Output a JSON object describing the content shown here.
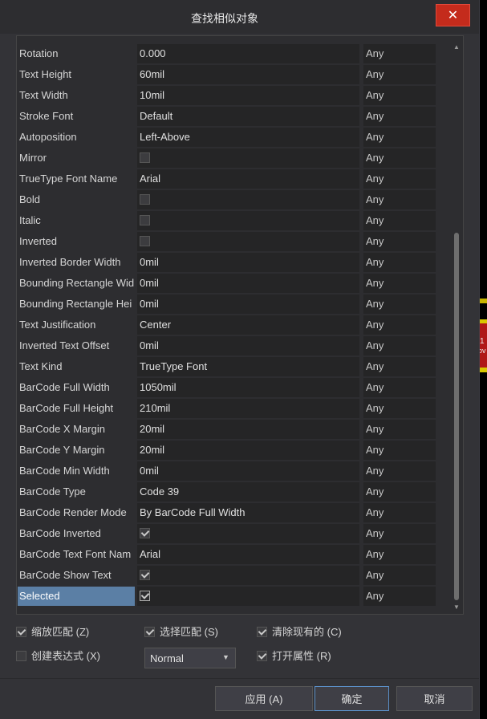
{
  "dialog": {
    "title": "查找相似对象",
    "close_label": "✕"
  },
  "rows": [
    {
      "label": "Rotation",
      "value": "0.000",
      "type": "text",
      "match": "Any"
    },
    {
      "label": "Text Height",
      "value": "60mil",
      "type": "text",
      "match": "Any"
    },
    {
      "label": "Text Width",
      "value": "10mil",
      "type": "text",
      "match": "Any"
    },
    {
      "label": "Stroke Font",
      "value": "Default",
      "type": "text",
      "match": "Any"
    },
    {
      "label": "Autoposition",
      "value": "Left-Above",
      "type": "text",
      "match": "Any"
    },
    {
      "label": "Mirror",
      "value": "",
      "type": "check",
      "checked": false,
      "match": "Any"
    },
    {
      "label": "TrueType Font Name",
      "value": "Arial",
      "type": "text",
      "match": "Any"
    },
    {
      "label": "Bold",
      "value": "",
      "type": "check",
      "checked": false,
      "match": "Any"
    },
    {
      "label": "Italic",
      "value": "",
      "type": "check",
      "checked": false,
      "match": "Any"
    },
    {
      "label": "Inverted",
      "value": "",
      "type": "check",
      "checked": false,
      "match": "Any"
    },
    {
      "label": "Inverted Border Width",
      "value": "0mil",
      "type": "text",
      "match": "Any"
    },
    {
      "label": "Bounding Rectangle Wid",
      "value": "0mil",
      "type": "text",
      "match": "Any"
    },
    {
      "label": "Bounding Rectangle Hei",
      "value": "0mil",
      "type": "text",
      "match": "Any"
    },
    {
      "label": "Text Justification",
      "value": "Center",
      "type": "text",
      "match": "Any"
    },
    {
      "label": "Inverted Text Offset",
      "value": "0mil",
      "type": "text",
      "match": "Any"
    },
    {
      "label": "Text Kind",
      "value": "TrueType Font",
      "type": "text",
      "match": "Any"
    },
    {
      "label": "BarCode Full Width",
      "value": "1050mil",
      "type": "text",
      "match": "Any"
    },
    {
      "label": "BarCode Full Height",
      "value": "210mil",
      "type": "text",
      "match": "Any"
    },
    {
      "label": "BarCode X Margin",
      "value": "20mil",
      "type": "text",
      "match": "Any"
    },
    {
      "label": "BarCode Y Margin",
      "value": "20mil",
      "type": "text",
      "match": "Any"
    },
    {
      "label": "BarCode Min Width",
      "value": "0mil",
      "type": "text",
      "match": "Any"
    },
    {
      "label": "BarCode Type",
      "value": "Code 39",
      "type": "text",
      "match": "Any"
    },
    {
      "label": "BarCode Render Mode",
      "value": "By BarCode Full Width",
      "type": "text",
      "match": "Any"
    },
    {
      "label": "BarCode Inverted",
      "value": "",
      "type": "check",
      "checked": true,
      "match": "Any"
    },
    {
      "label": "BarCode Text Font Nam",
      "value": "Arial",
      "type": "text",
      "match": "Any"
    },
    {
      "label": "BarCode Show Text",
      "value": "",
      "type": "check",
      "checked": true,
      "match": "Any"
    },
    {
      "label": "Selected",
      "value": "",
      "type": "check",
      "checked": true,
      "match": "Any",
      "selected": true
    }
  ],
  "options": {
    "zoom_match": {
      "label": "缩放匹配 (Z)",
      "checked": true
    },
    "select_match": {
      "label": "选择匹配 (S)",
      "checked": true
    },
    "clear_existing": {
      "label": "清除现有的 (C)",
      "checked": true
    },
    "create_expression": {
      "label": "创建表达式 (X)",
      "checked": false
    },
    "open_properties": {
      "label": "打开属性 (R)",
      "checked": true
    }
  },
  "mode_dropdown": {
    "value": "Normal"
  },
  "buttons": {
    "apply": "应用 (A)",
    "ok": "确定",
    "cancel": "取消"
  },
  "background": {
    "canvas_text": "1",
    "canvas_text2": "ov"
  }
}
